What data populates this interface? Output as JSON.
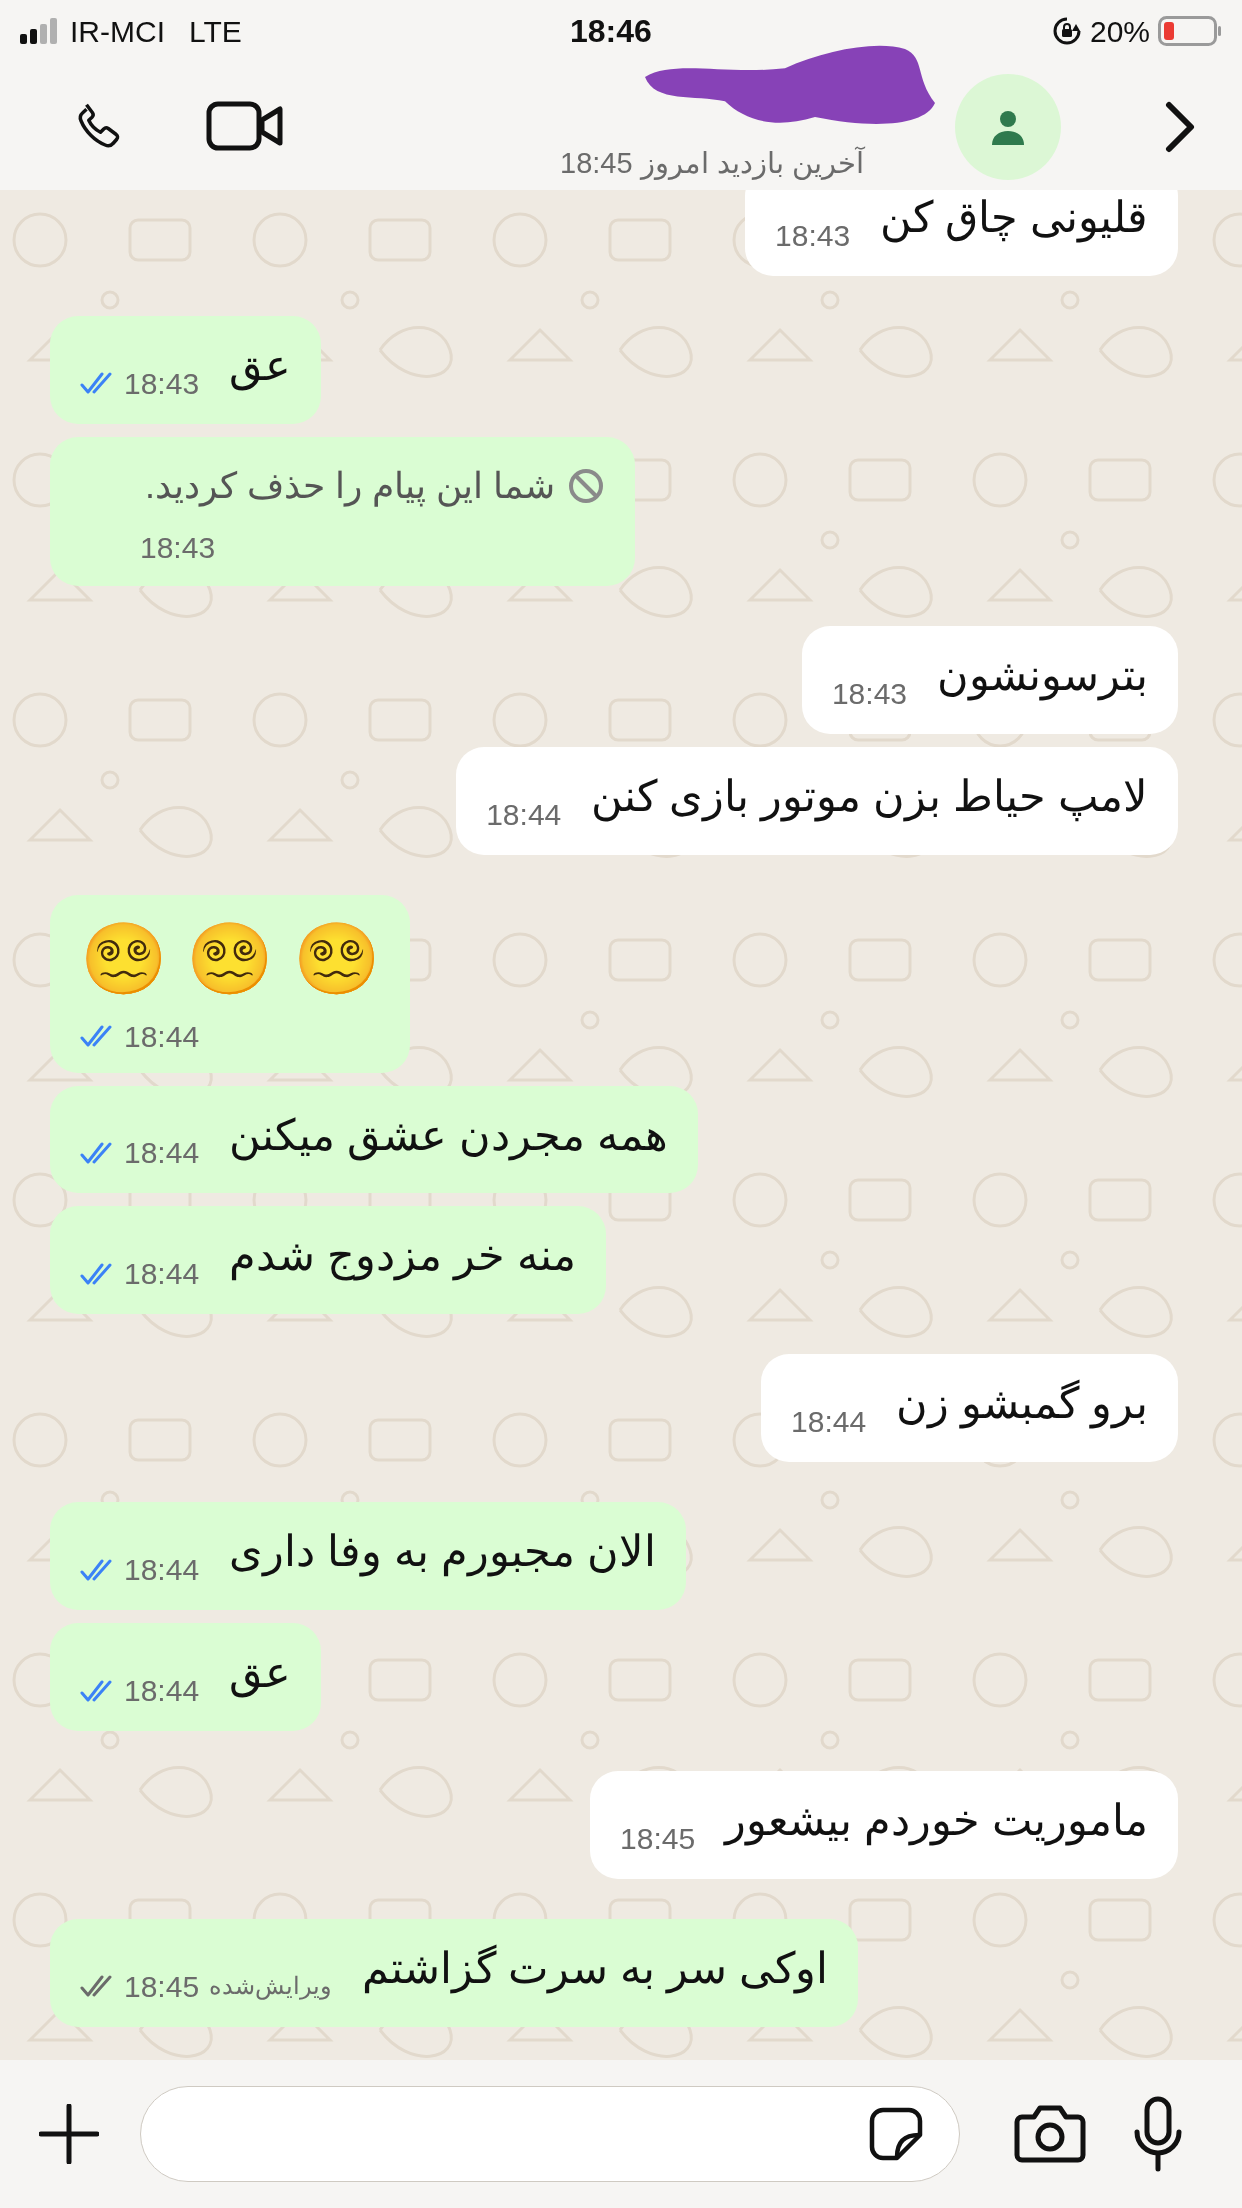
{
  "status_bar": {
    "carrier": "IR-MCI",
    "network": "LTE",
    "time": "18:46",
    "battery": "20%"
  },
  "header": {
    "last_seen": "آخرین بازدید امروز 18:45"
  },
  "messages": [
    {
      "kind": "text",
      "from_me": false,
      "text": "قلیونی چاق کن",
      "time": "18:43"
    },
    {
      "kind": "text",
      "from_me": true,
      "text": "عق",
      "time": "18:43",
      "read": true
    },
    {
      "kind": "deleted",
      "from_me": true,
      "text": "شما این پیام را حذف کردید.",
      "time": "18:43"
    },
    {
      "kind": "text",
      "from_me": false,
      "text": "بترسونشون",
      "time": "18:43"
    },
    {
      "kind": "text",
      "from_me": false,
      "text": "لامپ حیاط بزن موتور بازی کنن",
      "time": "18:44"
    },
    {
      "kind": "emoji",
      "from_me": true,
      "text": "😵‍💫 😵‍💫 😵‍💫",
      "time": "18:44",
      "read": true
    },
    {
      "kind": "text",
      "from_me": true,
      "text": "همه مجردن عشق میکنن",
      "time": "18:44",
      "read": true
    },
    {
      "kind": "text",
      "from_me": true,
      "text": "منه خر مزدوج شدم",
      "time": "18:44",
      "read": true
    },
    {
      "kind": "text",
      "from_me": false,
      "text": "برو گمبشو زن",
      "time": "18:44"
    },
    {
      "kind": "text",
      "from_me": true,
      "text": "الان مجبورم به وفا داری",
      "time": "18:44",
      "read": true
    },
    {
      "kind": "text",
      "from_me": true,
      "text": "عق",
      "time": "18:44",
      "read": true
    },
    {
      "kind": "text",
      "from_me": false,
      "text": "ماموریت خوردم بیشعور",
      "time": "18:45"
    },
    {
      "kind": "text",
      "from_me": true,
      "text": "اوکی سر به سرت گزاشتم",
      "time": "18:45",
      "read": false,
      "edited_label": "ویرایش‌شده"
    }
  ]
}
